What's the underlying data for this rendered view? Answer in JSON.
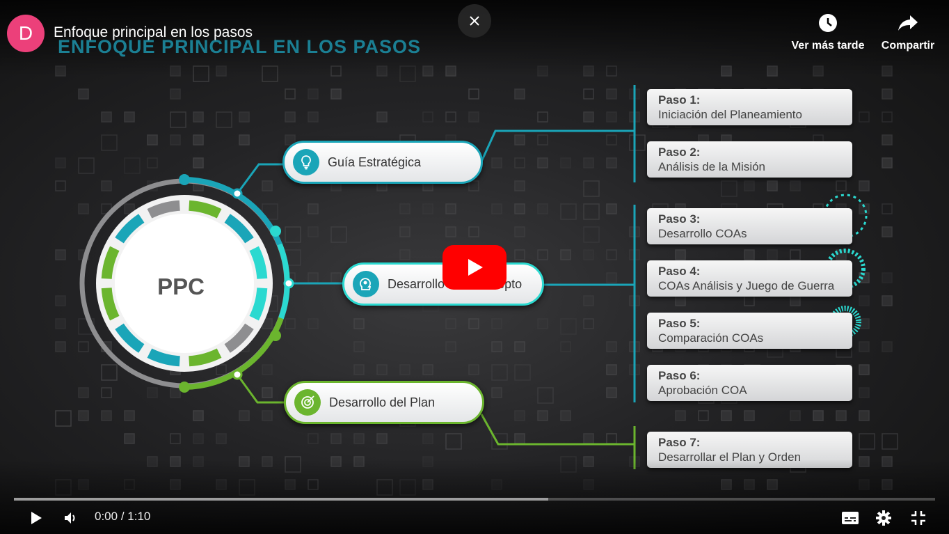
{
  "player": {
    "title": "Enfoque principal en los pasos",
    "channel_initial": "D",
    "close_icon": "close-icon",
    "actions": [
      {
        "label": "Ver más tarde",
        "icon": "clock-icon"
      },
      {
        "label": "Compartir",
        "icon": "share-arrow-icon"
      }
    ],
    "time_current": "0:00",
    "time_separator": "/",
    "time_total": "1:10",
    "played_fraction": 0.0,
    "buffered_fraction": 0.58,
    "state": "paused"
  },
  "slide": {
    "heading": "ENFOQUE PRINCIPAL EN LOS PASOS",
    "center_label": "PPC",
    "branches": [
      {
        "label": "Guía Estratégica",
        "icon": "lightbulb-icon",
        "color": "#1aa5b8"
      },
      {
        "label": "Desarrollo del Concepto",
        "icon": "head-gear-icon",
        "color": "#1aa5b8"
      },
      {
        "label": "Desarrollo del Plan",
        "icon": "target-arrow-icon",
        "color": "#6bb52e"
      }
    ],
    "steps": [
      {
        "number": "Paso 1:",
        "name": "Iniciación del Planeamiento"
      },
      {
        "number": "Paso 2:",
        "name": "Análisis de la Misión"
      },
      {
        "number": "Paso 3:",
        "name": "Desarrollo COAs"
      },
      {
        "number": "Paso 4:",
        "name": "COAs Análisis y Juego de Guerra"
      },
      {
        "number": "Paso 5:",
        "name": "Comparación COAs"
      },
      {
        "number": "Paso 6:",
        "name": "Aprobación COA"
      },
      {
        "number": "Paso 7:",
        "name": "Desarrollar el Plan y Orden"
      }
    ]
  },
  "colors": {
    "channel_avatar": "#ec407a",
    "youtube_red": "#ff0000",
    "teal": "#1aa5b8",
    "cyan": "#2bd9d0",
    "green": "#6bb52e",
    "heading": "#1b7f93"
  },
  "controls": {
    "play_icon": "play-icon",
    "volume_icon": "volume-icon",
    "subtitles_icon": "subtitles-icon",
    "settings_icon": "gear-icon",
    "exit_fullscreen_icon": "exit-fullscreen-icon"
  }
}
